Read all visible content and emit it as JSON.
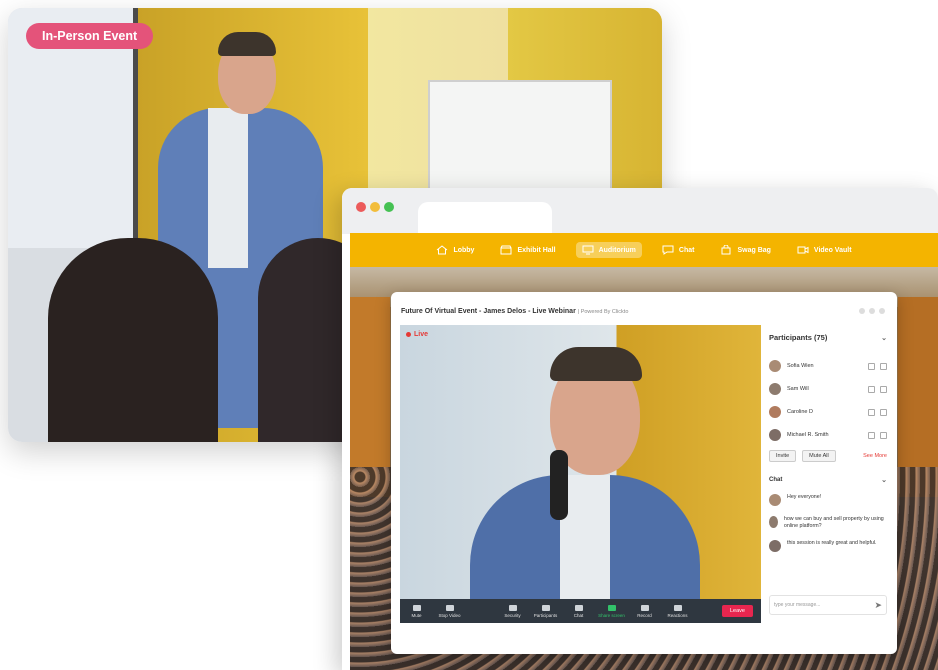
{
  "in_person": {
    "badge": "In-Person Event"
  },
  "browser": {
    "dots": [
      "#ec5b5b",
      "#f2bd3b",
      "#45c153"
    ],
    "nav": [
      {
        "label": "Lobby",
        "icon": "home-icon",
        "active": false
      },
      {
        "label": "Exhibit Hall",
        "icon": "store-icon",
        "active": false
      },
      {
        "label": "Auditorium",
        "icon": "monitor-icon",
        "active": true
      },
      {
        "label": "Chat",
        "icon": "chat-icon",
        "active": false
      },
      {
        "label": "Swag Bag",
        "icon": "bag-icon",
        "active": false
      },
      {
        "label": "Video Vault",
        "icon": "video-icon",
        "active": false
      }
    ],
    "accent": "#f4b400"
  },
  "webinar": {
    "title": "Future Of Virtual Event - James Delos - Live Webinar",
    "powered_by": "| Powered By Clickto",
    "live_label": "Live",
    "controls": [
      {
        "label": "Mute",
        "icon": "mic-icon"
      },
      {
        "label": "Stop Video",
        "icon": "camera-icon"
      },
      {
        "label": "Security",
        "icon": "shield-icon"
      },
      {
        "label": "Participants",
        "icon": "people-icon"
      },
      {
        "label": "Chat",
        "icon": "chat-icon"
      },
      {
        "label": "Share screen",
        "icon": "share-screen-icon"
      },
      {
        "label": "Record",
        "icon": "record-icon"
      },
      {
        "label": "Reactions",
        "icon": "smile-icon"
      }
    ],
    "leave_label": "Leave"
  },
  "participants": {
    "header": "Participants (75)",
    "list": [
      {
        "name": "Sofia Wien"
      },
      {
        "name": "Sam Will"
      },
      {
        "name": "Caroline D"
      },
      {
        "name": "Michael R. Smith"
      }
    ],
    "invite_label": "Invite",
    "mute_all_label": "Mute All",
    "see_more_label": "See More"
  },
  "chat": {
    "header": "Chat",
    "messages": [
      {
        "text": "Hey everyone!"
      },
      {
        "text": "how we can buy and  sell property by using online platform?"
      },
      {
        "text": "this session is really great and helpful."
      }
    ],
    "input_placeholder": "type your message..."
  }
}
